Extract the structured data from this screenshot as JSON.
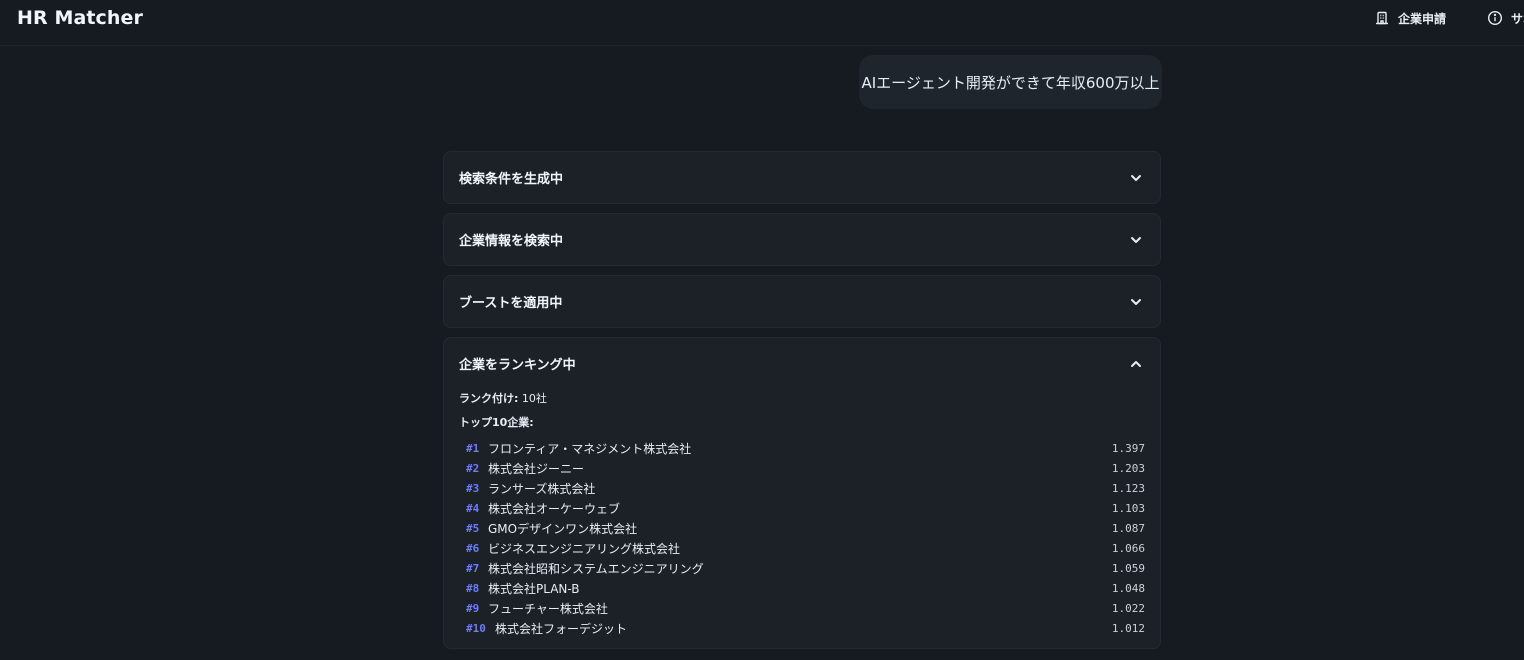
{
  "header": {
    "brand": "HR Matcher",
    "nav": {
      "company_apply": "企業申請",
      "support": "サポート"
    }
  },
  "chat": {
    "user_message": "AIエージェント開発ができて年収600万以上"
  },
  "steps": [
    {
      "label": "検索条件を生成中",
      "expanded": false
    },
    {
      "label": "企業情報を検索中",
      "expanded": false
    },
    {
      "label": "ブーストを適用中",
      "expanded": false
    },
    {
      "label": "企業をランキング中",
      "expanded": true
    }
  ],
  "ranking": {
    "count_label": "ランク付け:",
    "count_value": "10社",
    "top_title": "トップ10企業:",
    "items": [
      {
        "rank": "#1",
        "name": "フロンティア・マネジメント株式会社",
        "score": "1.397"
      },
      {
        "rank": "#2",
        "name": "株式会社ジーニー",
        "score": "1.203"
      },
      {
        "rank": "#3",
        "name": "ランサーズ株式会社",
        "score": "1.123"
      },
      {
        "rank": "#4",
        "name": "株式会社オーケーウェブ",
        "score": "1.103"
      },
      {
        "rank": "#5",
        "name": "GMOデザインワン株式会社",
        "score": "1.087"
      },
      {
        "rank": "#6",
        "name": "ビジネスエンジニアリング株式会社",
        "score": "1.066"
      },
      {
        "rank": "#7",
        "name": "株式会社昭和システムエンジニアリング",
        "score": "1.059"
      },
      {
        "rank": "#8",
        "name": "株式会社PLAN-B",
        "score": "1.048"
      },
      {
        "rank": "#9",
        "name": "フューチャー株式会社",
        "score": "1.022"
      },
      {
        "rank": "#10",
        "name": "株式会社フォーデジット",
        "score": "1.012"
      }
    ]
  },
  "colors": {
    "background": "#161b22",
    "panel": "#1c2128",
    "rank_accent": "#6e7cf6"
  },
  "icons": {
    "company_apply": "building-icon",
    "support": "info-circle-icon",
    "collapsed": "chevron-down-icon",
    "expanded": "chevron-up-icon"
  }
}
